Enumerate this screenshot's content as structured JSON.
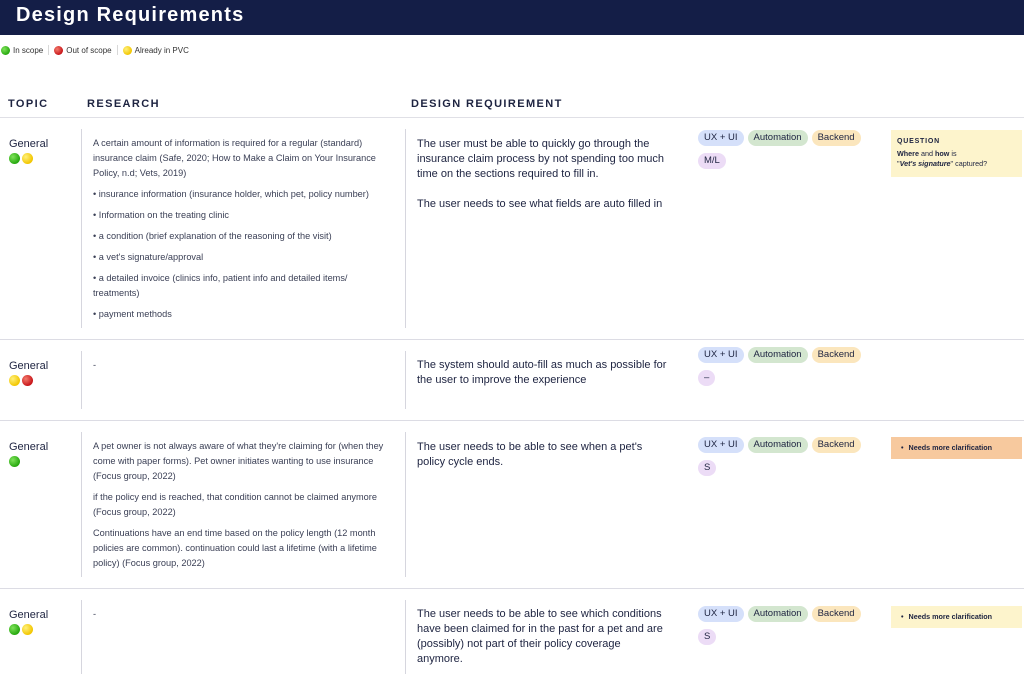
{
  "page": {
    "title": "Design Requirements"
  },
  "legend": [
    {
      "color": "green",
      "label": "In scope"
    },
    {
      "color": "red",
      "label": "Out of scope"
    },
    {
      "color": "yellow",
      "label": "Already in PVC"
    }
  ],
  "columns": {
    "topic": "TOPIC",
    "research": "RESEARCH",
    "requirement": "DESIGN REQUIREMENT"
  },
  "tag_labels": {
    "ux": "UX + UI",
    "automation": "Automation",
    "backend": "Backend"
  },
  "colors": {
    "header_bg": "#141e47",
    "in_scope": "#27a80f",
    "out_of_scope": "#c8161a",
    "already_in_pvc": "#f2c600",
    "tag_ux": "#d5e0fa",
    "tag_automation": "#d3e6cf",
    "tag_backend": "#fbe6bd",
    "tag_size": "#ecdcf6",
    "note_yellow": "#fdf4cc",
    "note_orange": "#f7c99e"
  },
  "rows": [
    {
      "topic": "General",
      "status": [
        "green",
        "yellow"
      ],
      "research": [
        "A certain amount of information is required for a regular (standard) insurance claim (Safe, 2020; How to Make a Claim on Your Insurance Policy, n.d; Vets, 2019)",
        "• insurance information (insurance holder, which pet, policy number)",
        "• Information on the treating clinic",
        "• a condition (brief explanation of the reasoning of the visit)",
        "• a vet's signature/approval",
        "• a detailed invoice (clinics info, patient info and detailed items/ treatments)",
        "• payment methods"
      ],
      "requirement": [
        "The user must be able to quickly go through the insurance claim process by not spending too much time on the sections required to fill in.",
        "The user needs to see what fields are auto filled in"
      ],
      "size": "M/L",
      "note": {
        "type": "question",
        "title": "QUESTION",
        "where": "Where",
        "and": " and ",
        "how": "how",
        "is": " is",
        "quote_open": "\"",
        "subject": "Vet's signature",
        "quote_close": "\"",
        "end": " captured?"
      }
    },
    {
      "topic": "General",
      "status": [
        "yellow",
        "red"
      ],
      "research": [
        "-"
      ],
      "requirement": [
        "The system should auto-fill as much as possible for the user to improve the experience"
      ],
      "size": "–"
    },
    {
      "topic": "General",
      "status": [
        "green"
      ],
      "research": [
        "A pet owner is not always aware of what they're claiming for (when they come with paper forms). Pet owner initiates wanting to use insurance (Focus group, 2022)",
        "if the policy end is reached, that condition cannot be claimed anymore (Focus group, 2022)",
        "Continuations have an end time based on the policy length (12 month policies are common). continuation could last a lifetime (with a lifetime policy) (Focus group, 2022)"
      ],
      "requirement": [
        "The user needs to be able to see when a pet's policy cycle ends."
      ],
      "size": "S",
      "note": {
        "type": "orange",
        "text": "Needs more clarification"
      }
    },
    {
      "topic": "General",
      "status": [
        "green",
        "yellow"
      ],
      "research": [
        "-"
      ],
      "requirement": [
        "The user needs to be able to see which conditions have been claimed for in the past for a pet and are (possibly) not part of their policy coverage anymore."
      ],
      "size": "S",
      "note": {
        "type": "yellow",
        "text": "Needs more clarification"
      }
    }
  ]
}
